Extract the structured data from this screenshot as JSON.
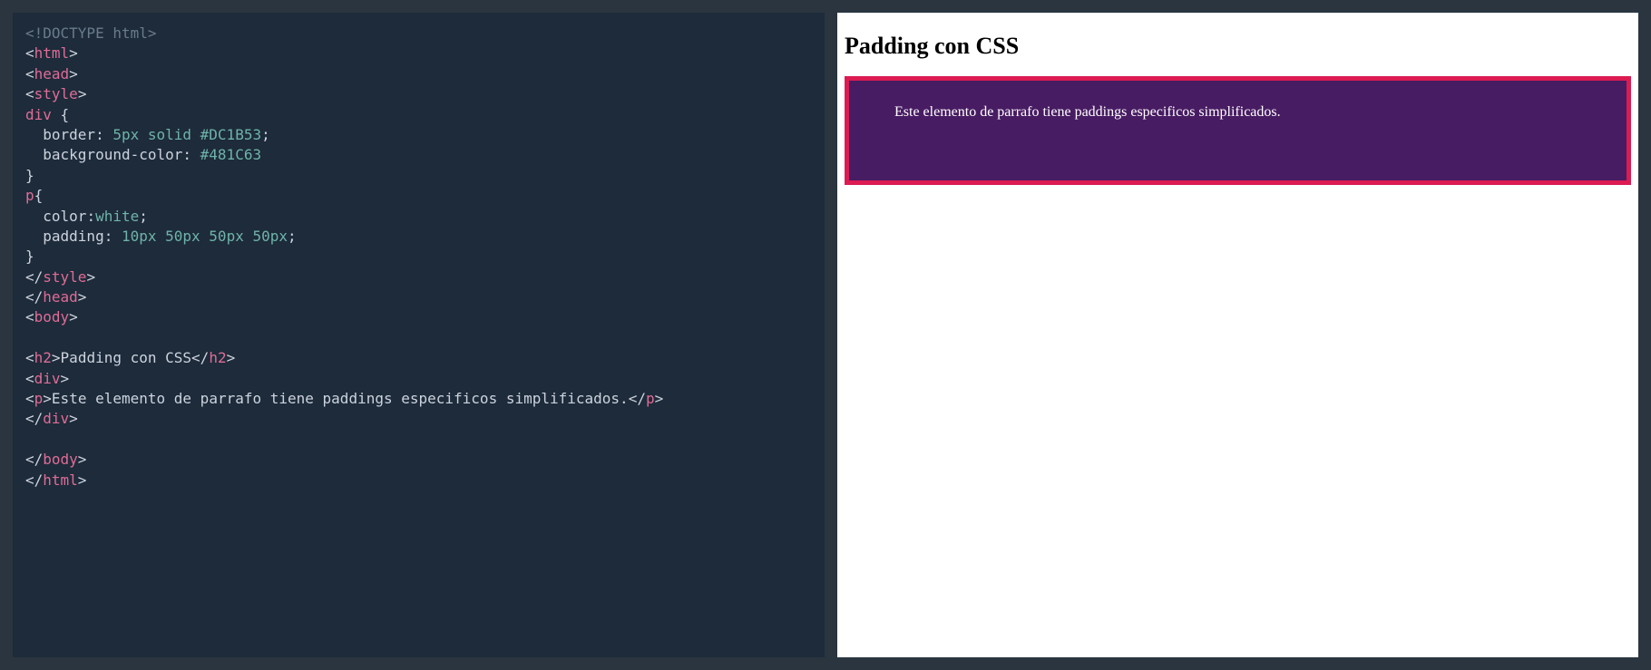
{
  "code": {
    "lines": [
      [
        {
          "c": "doctype",
          "t": "<!DOCTYPE html>"
        }
      ],
      [
        {
          "c": "punct",
          "t": "<"
        },
        {
          "c": "tag",
          "t": "html"
        },
        {
          "c": "punct",
          "t": ">"
        }
      ],
      [
        {
          "c": "punct",
          "t": "<"
        },
        {
          "c": "tag",
          "t": "head"
        },
        {
          "c": "punct",
          "t": ">"
        }
      ],
      [
        {
          "c": "punct",
          "t": "<"
        },
        {
          "c": "tag",
          "t": "style"
        },
        {
          "c": "punct",
          "t": ">"
        }
      ],
      [
        {
          "c": "sel",
          "t": "div"
        },
        {
          "c": "plain",
          "t": " {"
        }
      ],
      [
        {
          "c": "plain",
          "t": "  border"
        },
        {
          "c": "punct",
          "t": ": "
        },
        {
          "c": "value",
          "t": "5px solid #DC1B53"
        },
        {
          "c": "punct",
          "t": ";"
        }
      ],
      [
        {
          "c": "plain",
          "t": "  background-color"
        },
        {
          "c": "punct",
          "t": ": "
        },
        {
          "c": "value",
          "t": "#481C63"
        }
      ],
      [
        {
          "c": "plain",
          "t": "}"
        }
      ],
      [
        {
          "c": "sel",
          "t": "p"
        },
        {
          "c": "plain",
          "t": "{"
        }
      ],
      [
        {
          "c": "plain",
          "t": "  color"
        },
        {
          "c": "punct",
          "t": ":"
        },
        {
          "c": "value",
          "t": "white"
        },
        {
          "c": "punct",
          "t": ";"
        }
      ],
      [
        {
          "c": "plain",
          "t": "  padding"
        },
        {
          "c": "punct",
          "t": ": "
        },
        {
          "c": "value",
          "t": "10px 50px 50px 50px"
        },
        {
          "c": "punct",
          "t": ";"
        }
      ],
      [
        {
          "c": "plain",
          "t": "}"
        }
      ],
      [
        {
          "c": "punct",
          "t": "</"
        },
        {
          "c": "tag",
          "t": "style"
        },
        {
          "c": "punct",
          "t": ">"
        }
      ],
      [
        {
          "c": "punct",
          "t": "</"
        },
        {
          "c": "tag",
          "t": "head"
        },
        {
          "c": "punct",
          "t": ">"
        }
      ],
      [
        {
          "c": "punct",
          "t": "<"
        },
        {
          "c": "tag",
          "t": "body"
        },
        {
          "c": "punct",
          "t": ">"
        }
      ],
      [
        {
          "c": "plain",
          "t": ""
        }
      ],
      [
        {
          "c": "punct",
          "t": "<"
        },
        {
          "c": "tag",
          "t": "h2"
        },
        {
          "c": "punct",
          "t": ">"
        },
        {
          "c": "plain",
          "t": "Padding con CSS"
        },
        {
          "c": "punct",
          "t": "</"
        },
        {
          "c": "tag",
          "t": "h2"
        },
        {
          "c": "punct",
          "t": ">"
        }
      ],
      [
        {
          "c": "punct",
          "t": "<"
        },
        {
          "c": "tag",
          "t": "div"
        },
        {
          "c": "punct",
          "t": ">"
        }
      ],
      [
        {
          "c": "punct",
          "t": "<"
        },
        {
          "c": "tag",
          "t": "p"
        },
        {
          "c": "punct",
          "t": ">"
        },
        {
          "c": "plain",
          "t": "Este elemento de parrafo tiene paddings especificos simplificados."
        },
        {
          "c": "punct",
          "t": "</"
        },
        {
          "c": "tag",
          "t": "p"
        },
        {
          "c": "punct",
          "t": ">"
        }
      ],
      [
        {
          "c": "punct",
          "t": "</"
        },
        {
          "c": "tag",
          "t": "div"
        },
        {
          "c": "punct",
          "t": ">"
        }
      ],
      [
        {
          "c": "plain",
          "t": ""
        }
      ],
      [
        {
          "c": "punct",
          "t": "</"
        },
        {
          "c": "tag",
          "t": "body"
        },
        {
          "c": "punct",
          "t": ">"
        }
      ],
      [
        {
          "c": "punct",
          "t": "</"
        },
        {
          "c": "tag",
          "t": "html"
        },
        {
          "c": "punct",
          "t": ">"
        }
      ]
    ]
  },
  "preview": {
    "heading": "Padding con CSS",
    "paragraph": "Este elemento de parrafo tiene paddings especificos simplificados.",
    "box_border_color": "#DC1B53",
    "box_bg_color": "#481C63"
  }
}
